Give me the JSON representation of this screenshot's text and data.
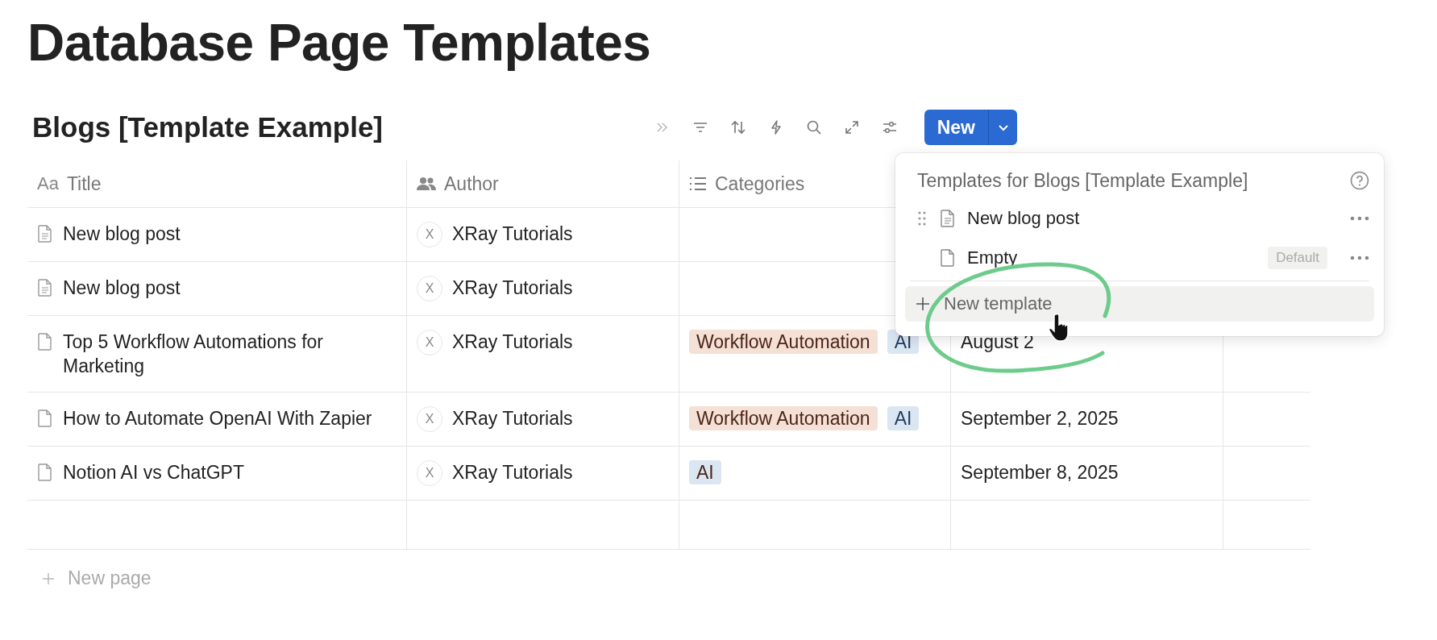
{
  "page_title": "Database Page Templates",
  "database": {
    "title": "Blogs [Template Example]",
    "new_button": {
      "label": "New"
    }
  },
  "table": {
    "columns": [
      {
        "label": "Title",
        "kind": "title",
        "glyph": "Aa"
      },
      {
        "label": "Author",
        "kind": "person"
      },
      {
        "label": "Categories",
        "kind": "multi_select"
      }
    ],
    "rows": [
      {
        "title": "New blog post",
        "has_content": true,
        "author": {
          "initial": "X",
          "name": "XRay Tutorials"
        },
        "tags": [],
        "date": ""
      },
      {
        "title": "New blog post",
        "has_content": true,
        "author": {
          "initial": "X",
          "name": "XRay Tutorials"
        },
        "tags": [],
        "date": ""
      },
      {
        "title": "Top 5 Workflow Automations for Marketing",
        "has_content": false,
        "author": {
          "initial": "X",
          "name": "XRay Tutorials"
        },
        "tags": [
          {
            "label": "Workflow Automation",
            "color": "#f5e0d6"
          },
          {
            "label": "AI",
            "color": "#dbe6f3"
          }
        ],
        "date": "August 2"
      },
      {
        "title": "How to Automate OpenAI With Zapier",
        "has_content": false,
        "author": {
          "initial": "X",
          "name": "XRay Tutorials"
        },
        "tags": [
          {
            "label": "Workflow Automation",
            "color": "#f5e0d6"
          },
          {
            "label": "AI",
            "color": "#dbe6f3"
          }
        ],
        "date": "September 2, 2025"
      },
      {
        "title": "Notion AI vs ChatGPT",
        "has_content": false,
        "author": {
          "initial": "X",
          "name": "XRay Tutorials"
        },
        "tags": [
          {
            "label": "AI",
            "color": "#dbe6f3"
          }
        ],
        "date": "September 8, 2025"
      }
    ],
    "new_page": "New page"
  },
  "templates_menu": {
    "title": "Templates for Blogs [Template Example]",
    "items": [
      {
        "label": "New blog post",
        "has_content": true,
        "hovered": true
      },
      {
        "label": "Empty",
        "has_content": false,
        "hovered": false,
        "badge": "Default"
      }
    ],
    "new_template": {
      "label": "New template",
      "highlighted": true
    }
  }
}
